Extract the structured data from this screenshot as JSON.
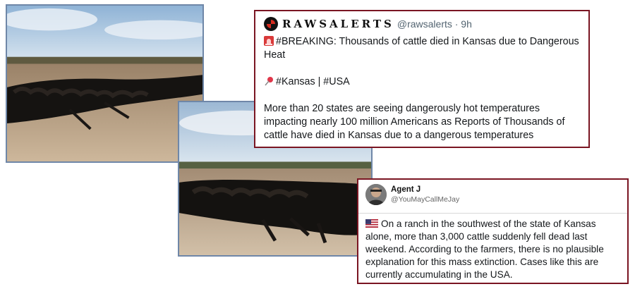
{
  "photos": [
    {
      "name": "cattle-photo-field-wide",
      "description_icon": "photo"
    },
    {
      "name": "cattle-photo-field-close",
      "description_icon": "photo"
    }
  ],
  "tweet_top": {
    "account_name": "RAWSALERTS",
    "handle_time": "@rawsalerts · 9h",
    "headline_icon": "siren-emoji",
    "headline": "#BREAKING: Thousands of cattle died in Kansas due to Dangerous Heat",
    "location_icon": "pushpin-emoji",
    "location": "#Kansas | #USA",
    "body": "More than 20 states are seeing dangerously hot temperatures impacting nearly 100 million Americans as Reports of Thousands of cattle have died in Kansas due to a dangerous temperatures"
  },
  "tweet_bottom": {
    "display_name": "Agent J",
    "handle": "@YouMayCallMeJay",
    "flag_icon": "us-flag-emoji",
    "body": "On a ranch in the southwest of the state of Kansas alone, more than 3,000 cattle suddenly fell dead last weekend. According to the farmers, there is no plausible explanation for this mass extinction. Cases like this are currently accumulating in the USA."
  },
  "colors": {
    "card_border": "#7a1522",
    "photo_border": "#6f87a8",
    "handle_gray": "#536471"
  }
}
